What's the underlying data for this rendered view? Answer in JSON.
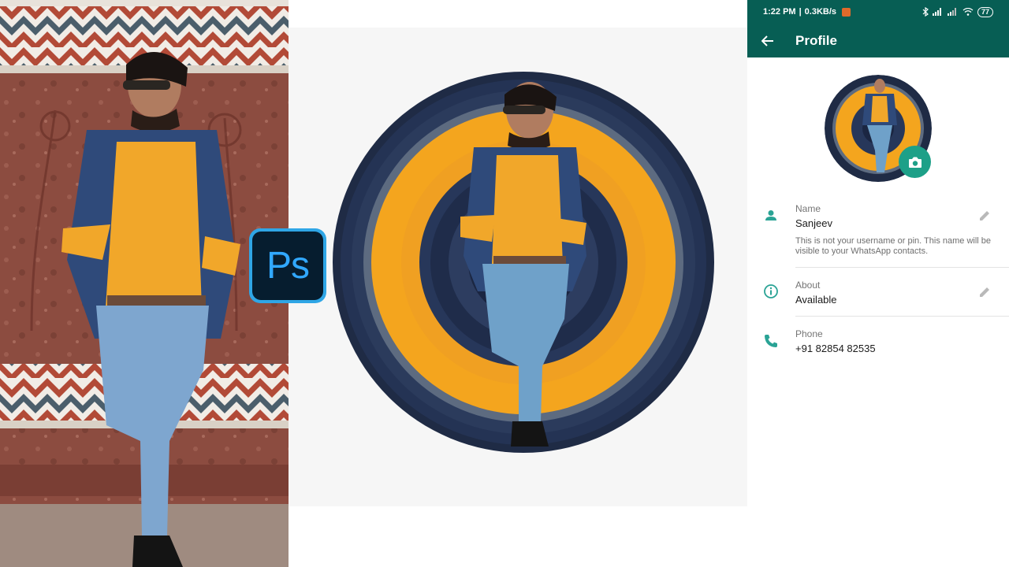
{
  "badge": {
    "text": "Ps",
    "name": "Adobe Photoshop"
  },
  "status_bar": {
    "time": "1:22 PM",
    "speed": "0.3KB/s",
    "battery": "77"
  },
  "app_bar": {
    "title": "Profile"
  },
  "profile": {
    "name": {
      "label": "Name",
      "value": "Sanjeev",
      "hint": "This is not your username or pin. This name will be visible to your WhatsApp contacts."
    },
    "about": {
      "label": "About",
      "value": "Available"
    },
    "phone": {
      "label": "Phone",
      "value": "+91 82854 82535"
    }
  },
  "colors": {
    "teal_dark": "#075e54",
    "accent": "#1da088",
    "ring_navy": "#1f2b45",
    "ring_yellow": "#f4a51e",
    "ps_blue": "#31a8ff",
    "ps_bg": "#061d2f"
  },
  "icons": [
    "back-arrow-icon",
    "camera-icon",
    "person-icon",
    "info-icon",
    "phone-icon",
    "pencil-icon",
    "bluetooth-icon",
    "signal-icon",
    "wifi-icon",
    "battery-icon"
  ]
}
